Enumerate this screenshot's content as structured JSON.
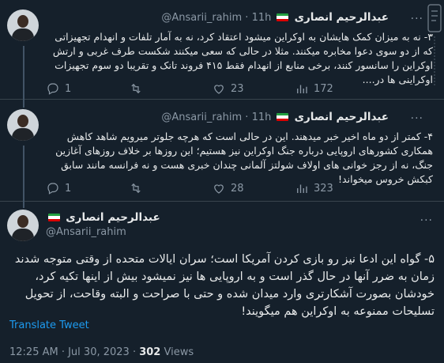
{
  "colors": {
    "background": "#15202b",
    "text": "#e7e9ea",
    "muted": "#8b98a5",
    "link": "#1d9bf0",
    "divider": "#38444d"
  },
  "tweets": [
    {
      "name": "عبدالرحیم انصاری",
      "handle": "@Ansarii_rahim",
      "time": "11h",
      "text": "۳- نه به میزان کمک هایشان به اوکراین میشود اعتقاد کرد، نه به آمار تلفات و انهدام تجهیزاتی که از دو سوی دعوا مخابره میکنند. مثلا در حالی که سعی میکنند شکست طرف غربی و ارتش اوکراین را سانسور کنند، برخی منابع از انهدام فقط ۴۱۵ فروند تانک و تقریبا دو سوم تجهیزات اوکراینی ها در....",
      "replies": "1",
      "retweets": "",
      "likes": "23",
      "views": "172"
    },
    {
      "name": "عبدالرحیم انصاری",
      "handle": "@Ansarii_rahim",
      "time": "11h",
      "text": "۴- کمتر از دو ماه اخیر خبر میدهند. این در حالی است که هرچه جلوتر میرویم شاهد کاهش همکاری کشورهای اروپایی درباره جنگ اوکراین نیز هستیم؛ این روزها بر خلاف روزهای آغازین جنگ، نه از رجز خوانی های اولاف شولتز آلمانی چندان خبری هست و نه فرانسه مانند سابق کبکش خروس میخواند!",
      "replies": "1",
      "retweets": "",
      "likes": "28",
      "views": "323"
    }
  ],
  "main_tweet": {
    "name": "عبدالرحیم انصاری",
    "handle": "@Ansarii_rahim",
    "text": "۵- گواه این ادعا نیز رو بازی کردن آمریکا است؛ سران ایالات متحده از وقتی متوجه شدند زمان به ضرر آنها در حال گذر است و به اروپایی ها نیز نمیشود بیش از اینها تکیه کرد، خودشان بصورت آشکارتری وارد میدان شده و حتی با صراحت و البته وقاحت، از تحویل تسلیحات ممنوعه به اوکراین هم میگویند!",
    "translate_label": "Translate Tweet",
    "time": "12:25 AM · Jul 30, 2023 · ",
    "views_count": "302",
    "views_label": " Views"
  },
  "icons": [
    "more-icon",
    "reply-icon",
    "retweet-icon",
    "like-icon",
    "views-icon",
    "flag-icon",
    "avatar"
  ]
}
